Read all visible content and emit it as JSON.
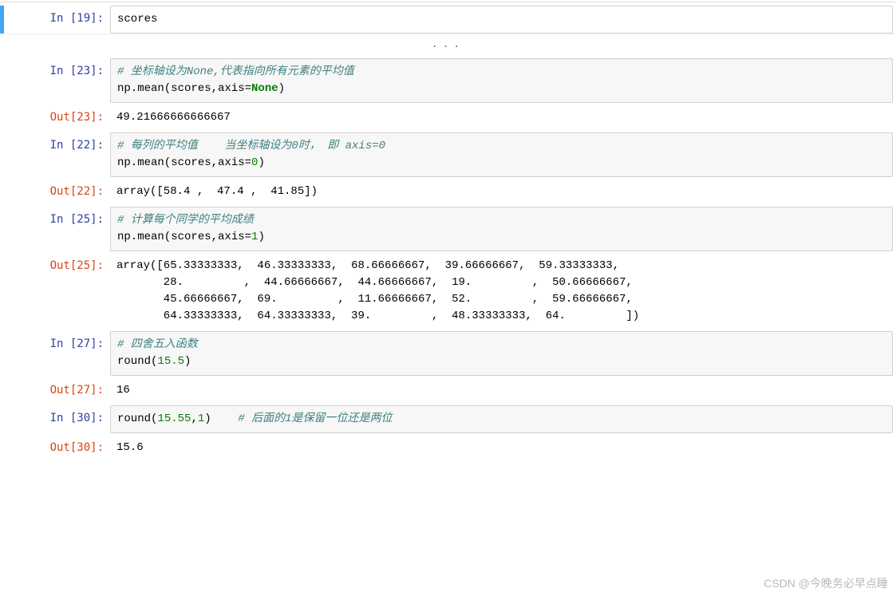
{
  "cells": {
    "c19": {
      "in_prompt": "In  [19]:",
      "code_plain": "scores",
      "dots": "..."
    },
    "c23": {
      "in_prompt": "In  [23]:",
      "comment": "# 坐标轴设为None,代表指向所有元素的平均值",
      "code_prefix": "np.mean(scores,axis=",
      "code_none": "None",
      "code_suffix": ")",
      "out_prompt": "Out[23]:",
      "output": "49.21666666666667"
    },
    "c22": {
      "in_prompt": "In  [22]:",
      "comment": "# 每列的平均值    当坐标轴设为0时， 即 axis=0",
      "code_prefix": "np.mean(scores,axis=",
      "code_num": "0",
      "code_suffix": ")",
      "out_prompt": "Out[22]:",
      "output": "array([58.4 ,  47.4 ,  41.85])"
    },
    "c25": {
      "in_prompt": "In  [25]:",
      "comment": "# 计算每个同学的平均成绩",
      "code_prefix": "np.mean(scores,axis=",
      "code_num": "1",
      "code_suffix": ")",
      "out_prompt": "Out[25]:",
      "output": "array([65.33333333,  46.33333333,  68.66666667,  39.66666667,  59.33333333,\n       28.         ,  44.66666667,  44.66666667,  19.         ,  50.66666667,\n       45.66666667,  69.         ,  11.66666667,  52.         ,  59.66666667,\n       64.33333333,  64.33333333,  39.         ,  48.33333333,  64.         ])"
    },
    "c27": {
      "in_prompt": "In  [27]:",
      "comment": "# 四舍五入函数",
      "code_prefix": "round(",
      "code_num": "15.5",
      "code_suffix": ")",
      "out_prompt": "Out[27]:",
      "output": "16"
    },
    "c30": {
      "in_prompt": "In  [30]:",
      "code_prefix": "round(",
      "code_num1": "15.55",
      "code_sep": ",",
      "code_num2": "1",
      "code_suffix": ")    ",
      "comment": "# 后面的1是保留一位还是两位",
      "out_prompt": "Out[30]:",
      "output": "15.6"
    }
  },
  "watermark": "CSDN @今晚务必早点睡"
}
